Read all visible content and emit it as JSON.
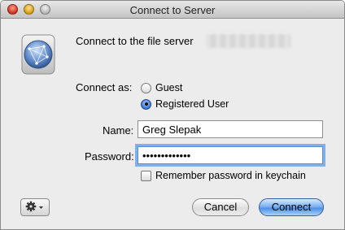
{
  "window": {
    "title": "Connect to Server"
  },
  "dialog": {
    "heading": "Connect to the file server",
    "connect_as_label": "Connect as:",
    "options": [
      {
        "label": "Guest",
        "selected": false
      },
      {
        "label": "Registered User",
        "selected": true
      }
    ],
    "name_label": "Name:",
    "name_value": "Greg Slepak",
    "password_label": "Password:",
    "password_value": "•••••••••••••",
    "remember_label": "Remember password in keychain",
    "remember_checked": false,
    "cancel_label": "Cancel",
    "connect_label": "Connect"
  },
  "icons": {
    "server": "network-globe-icon",
    "action": "gear-icon"
  },
  "colors": {
    "focus_ring": "#7fb0ea",
    "default_button": "#4d8fe6"
  }
}
